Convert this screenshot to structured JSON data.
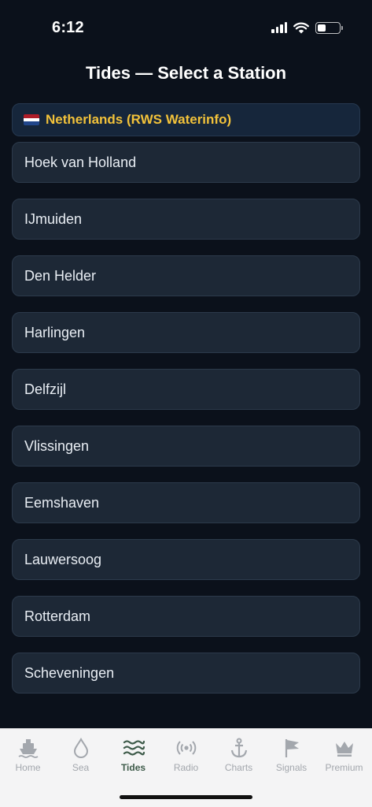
{
  "status": {
    "time": "6:12"
  },
  "title": "Tides — Select a Station",
  "region": {
    "label": "Netherlands (RWS Waterinfo)",
    "flag_colors": [
      "#ae1c28",
      "#ffffff",
      "#21468b"
    ]
  },
  "stations": [
    "Hoek van Holland",
    "IJmuiden",
    "Den Helder",
    "Harlingen",
    "Delfzijl",
    "Vlissingen",
    "Eemshaven",
    "Lauwersoog",
    "Rotterdam",
    "Scheveningen"
  ],
  "tabs": [
    {
      "label": "Home",
      "icon": "ship-icon"
    },
    {
      "label": "Sea",
      "icon": "water-drop-icon"
    },
    {
      "label": "Tides",
      "icon": "waves-icon",
      "active": true
    },
    {
      "label": "Radio",
      "icon": "radio-icon"
    },
    {
      "label": "Charts",
      "icon": "anchor-icon"
    },
    {
      "label": "Signals",
      "icon": "flag-icon"
    },
    {
      "label": "Premium",
      "icon": "crown-icon"
    }
  ],
  "colors": {
    "accent": "#f2c23a",
    "active_tab": "#3e5b4a",
    "inactive_tab": "#a3a7ad",
    "background": "#0b111b"
  }
}
